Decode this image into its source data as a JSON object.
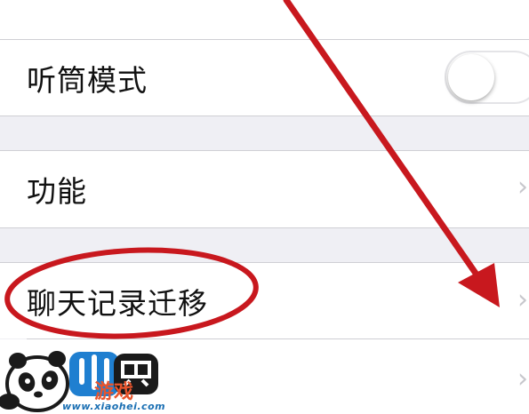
{
  "settings": {
    "rows": [
      {
        "label": "听筒模式",
        "control": "toggle",
        "toggle_on": false
      },
      {
        "label": "功能",
        "control": "chevron"
      },
      {
        "label": "聊天记录迁移",
        "control": "chevron"
      },
      {
        "label": "",
        "control": "chevron"
      }
    ],
    "chevron_glyph": "›"
  },
  "annotation": {
    "color": "#c8181e",
    "shapes": [
      "ellipse-highlight",
      "arrow"
    ]
  },
  "watermark": {
    "brand_text": "游戏",
    "url": "www.xiaohei.com"
  }
}
